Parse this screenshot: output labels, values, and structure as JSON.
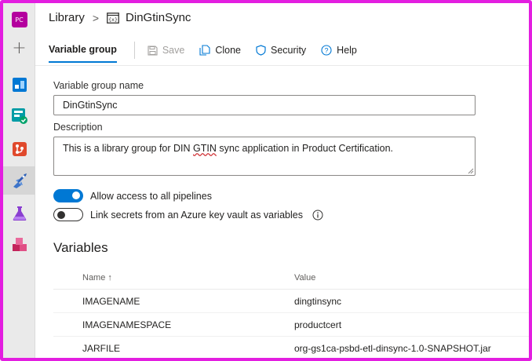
{
  "org_badge": "PC",
  "breadcrumb": {
    "root": "Library",
    "current": "DinGtinSync"
  },
  "toolbar": {
    "active_tab": "Variable group",
    "save": "Save",
    "clone": "Clone",
    "security": "Security",
    "help": "Help"
  },
  "form": {
    "name_label": "Variable group name",
    "name_value": "DinGtinSync",
    "description_label": "Description",
    "description_before": "This is a library group for DIN ",
    "description_flagged": "GTIN",
    "description_after": " sync application in Product Certification.",
    "allow_access_label": "Allow access to all pipelines",
    "allow_access_on": true,
    "link_secrets_label": "Link secrets from an Azure key vault as variables",
    "link_secrets_on": false
  },
  "variables": {
    "title": "Variables",
    "headers": {
      "name": "Name ↑",
      "value": "Value"
    },
    "rows": [
      {
        "name": "IMAGENAME",
        "value": "dingtinsync"
      },
      {
        "name": "IMAGENAMESPACE",
        "value": "productcert"
      },
      {
        "name": "JARFILE",
        "value": "org-gs1ca-psbd-etl-dinsync-1.0-SNAPSHOT.jar"
      }
    ]
  },
  "colors": {
    "accent": "#0078d4",
    "frame": "#e31ee0",
    "org_badge": "#b4009e"
  },
  "rail_icons": [
    "org-badge",
    "plus-icon",
    "boards-icon",
    "test-plans-icon",
    "repos-icon",
    "pipelines-icon",
    "test-icon",
    "artifacts-icon"
  ]
}
